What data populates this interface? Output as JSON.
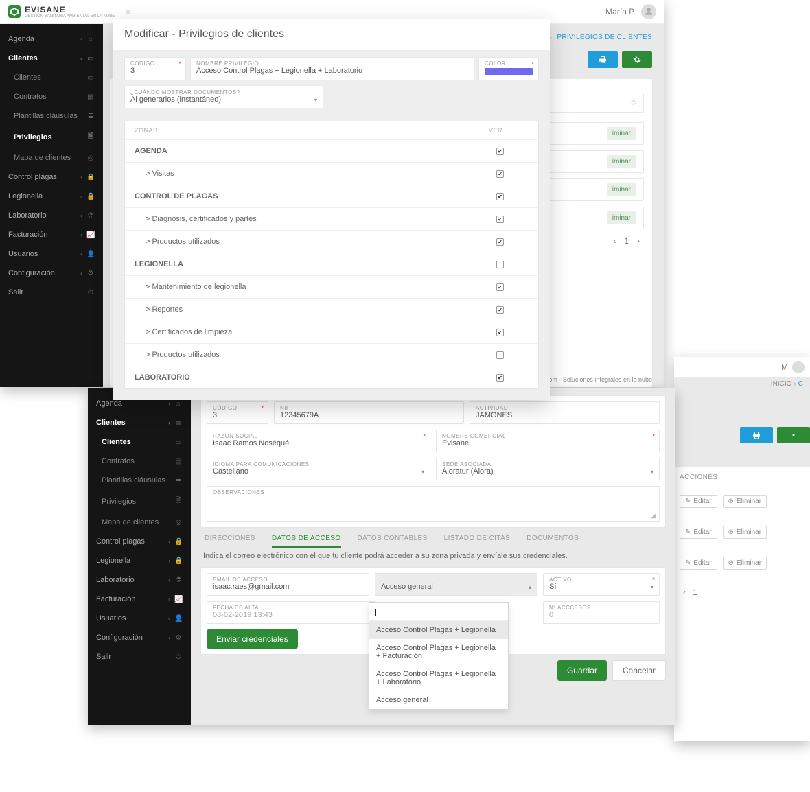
{
  "brand": {
    "name": "EVISANE",
    "sub": "GESTIÓN SANITARIA AMBIENTAL EN LA NUBE",
    "user": "María P."
  },
  "sidebar": {
    "items": [
      {
        "label": "Agenda"
      },
      {
        "label": "Clientes",
        "active": true
      },
      {
        "label": "Control plagas"
      },
      {
        "label": "Legionella"
      },
      {
        "label": "Laboratorio"
      },
      {
        "label": "Facturación"
      },
      {
        "label": "Usuarios"
      },
      {
        "label": "Configuración"
      },
      {
        "label": "Salir"
      }
    ],
    "sub": [
      {
        "label": "Clientes"
      },
      {
        "label": "Contratos"
      },
      {
        "label": "Plantillas cláusulas"
      },
      {
        "label": "Privilegios",
        "active": true
      },
      {
        "label": "Mapa de clientes"
      }
    ],
    "subB": [
      {
        "label": "Clientes",
        "active": true
      },
      {
        "label": "Contratos"
      },
      {
        "label": "Plantillas cláusulas"
      },
      {
        "label": "Privilegios"
      },
      {
        "label": "Mapa de clientes"
      }
    ]
  },
  "breadcrumbA": {
    "home": "INICIO",
    "current": "PRIVILEGIOS DE CLIENTES"
  },
  "breadcrumbB": {
    "home": "INICIO",
    "sep": "›",
    "next": "C"
  },
  "backlist": {
    "eliminar": "iminar",
    "pager_page": "1"
  },
  "backfooter": "· Evirom - Soluciones integrales en la nube",
  "modal": {
    "title": "Modificar - Privilegios de clientes",
    "codigo_label": "CÓDIGO",
    "codigo_val": "3",
    "nombre_label": "NOMBRE PRIVILEGIO",
    "nombre_val": "Acceso Control Plagas + Legionella + Laboratorio",
    "color_label": "COLOR",
    "cuando_label": "¿CUÁNDO MOSTRAR DOCUMENTOS?",
    "cuando_val": "Al generarlos (instantáneo)",
    "col_zonas": "ZONAS",
    "col_ver": "VER",
    "rows": [
      {
        "label": "AGENDA",
        "cat": true,
        "checked": true
      },
      {
        "label": "> Visitas",
        "checked": true
      },
      {
        "label": "CONTROL DE PLAGAS",
        "cat": true,
        "checked": true
      },
      {
        "label": "> Diagnosis, certificados y partes",
        "checked": true
      },
      {
        "label": "> Productos utilizados",
        "checked": true
      },
      {
        "label": "LEGIONELLA",
        "cat": true,
        "checked": false
      },
      {
        "label": "> Mantenimiento de legionella",
        "checked": true
      },
      {
        "label": "> Reportes",
        "checked": true
      },
      {
        "label": "> Certificados de limpieza",
        "checked": true
      },
      {
        "label": "> Productos utilizados",
        "checked": false
      },
      {
        "label": "LABORATORIO",
        "cat": true,
        "checked": true
      }
    ]
  },
  "client": {
    "codigo_label": "CÓDIGO",
    "codigo_val": "3",
    "nif_label": "NIF",
    "nif_val": "12345679A",
    "actividad_label": "ACTIVIDAD",
    "actividad_val": "JAMONES",
    "razon_label": "RAZÓN SOCIAL",
    "razon_val": "Isaac Ramos Noséqué",
    "nombrecom_label": "NOMBRE COMERCIAL",
    "nombrecom_val": "Evisane",
    "idioma_label": "IDIOMA PARA COMUNICACIONES",
    "idioma_val": "Castellano",
    "sede_label": "SEDE ASOCIADA",
    "sede_val": "Áloratur (Álora)",
    "obs_label": "OBSERVACIONES",
    "tabs": [
      "DIRECCIONES",
      "DATOS DE ACCESO",
      "DATOS CONTABLES",
      "LISTADO DE CITAS",
      "DOCUMENTOS"
    ],
    "hint": "Indica el correo electrónico con el que tu cliente podrá acceder a su zona privada y envíale sus credenciales.",
    "email_label": "EMAIL DE ACCESO",
    "email_val": "isaac.raes@gmail.com",
    "acceso_label": "Acceso general",
    "activo_label": "ACTIVO",
    "activo_val": "Sí",
    "fecha_label": "FECHA DE ALTA",
    "fecha_val": "08-02-2019 13:43",
    "naccesos_label": "Nº ACCCESOS",
    "naccesos_val": "0",
    "send": "Enviar credenciales",
    "save": "Guardar",
    "cancel": "Cancelar"
  },
  "combo": {
    "options": [
      "Acceso Control Plagas + Legionella",
      "Acceso Control Plagas + Legionella + Facturación",
      "Acceso Control Plagas + Legionella + Laboratorio",
      "Acceso general"
    ]
  },
  "tableB": {
    "acciones": "ACCIONES",
    "editar": "Editar",
    "eliminar": "Eliminar",
    "user": "M",
    "page": "1"
  }
}
